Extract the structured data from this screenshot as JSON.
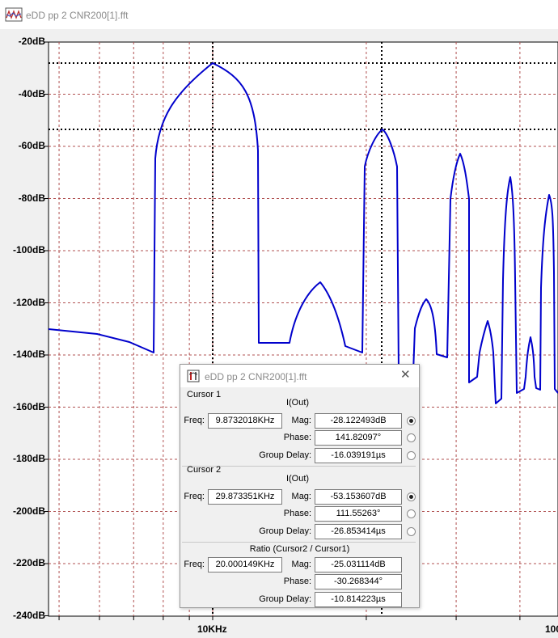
{
  "window": {
    "title": "eDD pp 2 CNR200[1].fft"
  },
  "plot": {
    "y_ticks": [
      "-20dB",
      "-40dB",
      "-60dB",
      "-80dB",
      "-100dB",
      "-120dB",
      "-140dB",
      "-160dB",
      "-180dB",
      "-200dB",
      "-220dB",
      "-240dB"
    ],
    "x_tick_main": "10KHz",
    "x_tick_right": "100",
    "trace_color": "#0000cc",
    "grid_color": "#b05050"
  },
  "cursor_dialog": {
    "title": "eDD pp 2 CNR200[1].fft",
    "close_glyph": "✕",
    "cursor1": {
      "group": "Cursor 1",
      "trace": "I(Out)",
      "freq_label": "Freq:",
      "freq": "9.8732018KHz",
      "mag_label": "Mag:",
      "mag": "-28.122493dB",
      "phase_label": "Phase:",
      "phase": "141.82097°",
      "gd_label": "Group Delay:",
      "group_delay": "-16.039191µs"
    },
    "cursor2": {
      "group": "Cursor 2",
      "trace": "I(Out)",
      "freq_label": "Freq:",
      "freq": "29.873351KHz",
      "mag_label": "Mag:",
      "mag": "-53.153607dB",
      "phase_label": "Phase:",
      "phase": "111.55263°",
      "gd_label": "Group Delay:",
      "group_delay": "-26.853414µs"
    },
    "ratio": {
      "group": "Ratio (Cursor2 / Cursor1)",
      "freq_label": "Freq:",
      "freq": "20.000149KHz",
      "mag_label": "Mag:",
      "mag": "-25.031114dB",
      "phase_label": "Phase:",
      "phase": "-30.268344°",
      "gd_label": "Group Delay:",
      "group_delay": "-10.814223µs"
    }
  }
}
